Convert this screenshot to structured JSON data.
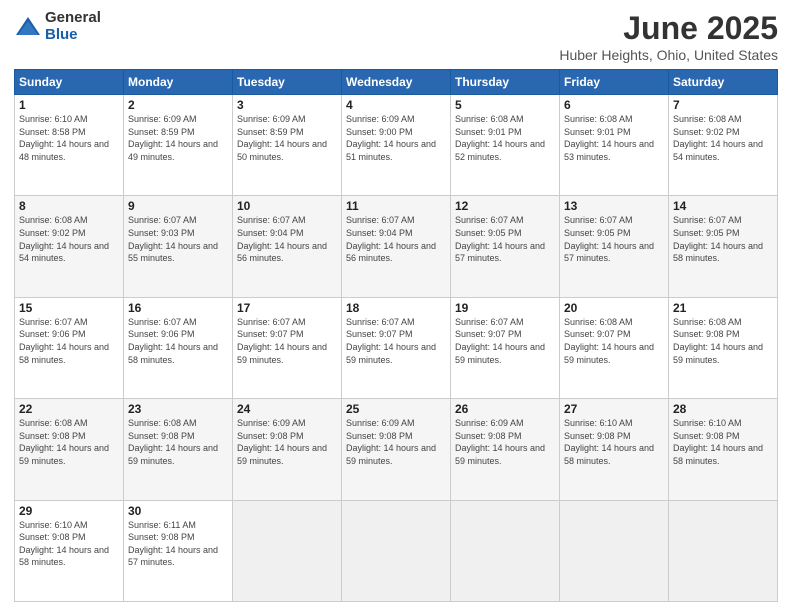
{
  "logo": {
    "general": "General",
    "blue": "Blue"
  },
  "title": "June 2025",
  "subtitle": "Huber Heights, Ohio, United States",
  "header": {
    "days": [
      "Sunday",
      "Monday",
      "Tuesday",
      "Wednesday",
      "Thursday",
      "Friday",
      "Saturday"
    ]
  },
  "weeks": [
    [
      {
        "day": "1",
        "sunrise": "6:10 AM",
        "sunset": "8:58 PM",
        "daylight": "14 hours and 48 minutes."
      },
      {
        "day": "2",
        "sunrise": "6:09 AM",
        "sunset": "8:59 PM",
        "daylight": "14 hours and 49 minutes."
      },
      {
        "day": "3",
        "sunrise": "6:09 AM",
        "sunset": "8:59 PM",
        "daylight": "14 hours and 50 minutes."
      },
      {
        "day": "4",
        "sunrise": "6:09 AM",
        "sunset": "9:00 PM",
        "daylight": "14 hours and 51 minutes."
      },
      {
        "day": "5",
        "sunrise": "6:08 AM",
        "sunset": "9:01 PM",
        "daylight": "14 hours and 52 minutes."
      },
      {
        "day": "6",
        "sunrise": "6:08 AM",
        "sunset": "9:01 PM",
        "daylight": "14 hours and 53 minutes."
      },
      {
        "day": "7",
        "sunrise": "6:08 AM",
        "sunset": "9:02 PM",
        "daylight": "14 hours and 54 minutes."
      }
    ],
    [
      {
        "day": "8",
        "sunrise": "6:08 AM",
        "sunset": "9:02 PM",
        "daylight": "14 hours and 54 minutes."
      },
      {
        "day": "9",
        "sunrise": "6:07 AM",
        "sunset": "9:03 PM",
        "daylight": "14 hours and 55 minutes."
      },
      {
        "day": "10",
        "sunrise": "6:07 AM",
        "sunset": "9:04 PM",
        "daylight": "14 hours and 56 minutes."
      },
      {
        "day": "11",
        "sunrise": "6:07 AM",
        "sunset": "9:04 PM",
        "daylight": "14 hours and 56 minutes."
      },
      {
        "day": "12",
        "sunrise": "6:07 AM",
        "sunset": "9:05 PM",
        "daylight": "14 hours and 57 minutes."
      },
      {
        "day": "13",
        "sunrise": "6:07 AM",
        "sunset": "9:05 PM",
        "daylight": "14 hours and 57 minutes."
      },
      {
        "day": "14",
        "sunrise": "6:07 AM",
        "sunset": "9:05 PM",
        "daylight": "14 hours and 58 minutes."
      }
    ],
    [
      {
        "day": "15",
        "sunrise": "6:07 AM",
        "sunset": "9:06 PM",
        "daylight": "14 hours and 58 minutes."
      },
      {
        "day": "16",
        "sunrise": "6:07 AM",
        "sunset": "9:06 PM",
        "daylight": "14 hours and 58 minutes."
      },
      {
        "day": "17",
        "sunrise": "6:07 AM",
        "sunset": "9:07 PM",
        "daylight": "14 hours and 59 minutes."
      },
      {
        "day": "18",
        "sunrise": "6:07 AM",
        "sunset": "9:07 PM",
        "daylight": "14 hours and 59 minutes."
      },
      {
        "day": "19",
        "sunrise": "6:07 AM",
        "sunset": "9:07 PM",
        "daylight": "14 hours and 59 minutes."
      },
      {
        "day": "20",
        "sunrise": "6:08 AM",
        "sunset": "9:07 PM",
        "daylight": "14 hours and 59 minutes."
      },
      {
        "day": "21",
        "sunrise": "6:08 AM",
        "sunset": "9:08 PM",
        "daylight": "14 hours and 59 minutes."
      }
    ],
    [
      {
        "day": "22",
        "sunrise": "6:08 AM",
        "sunset": "9:08 PM",
        "daylight": "14 hours and 59 minutes."
      },
      {
        "day": "23",
        "sunrise": "6:08 AM",
        "sunset": "9:08 PM",
        "daylight": "14 hours and 59 minutes."
      },
      {
        "day": "24",
        "sunrise": "6:09 AM",
        "sunset": "9:08 PM",
        "daylight": "14 hours and 59 minutes."
      },
      {
        "day": "25",
        "sunrise": "6:09 AM",
        "sunset": "9:08 PM",
        "daylight": "14 hours and 59 minutes."
      },
      {
        "day": "26",
        "sunrise": "6:09 AM",
        "sunset": "9:08 PM",
        "daylight": "14 hours and 59 minutes."
      },
      {
        "day": "27",
        "sunrise": "6:10 AM",
        "sunset": "9:08 PM",
        "daylight": "14 hours and 58 minutes."
      },
      {
        "day": "28",
        "sunrise": "6:10 AM",
        "sunset": "9:08 PM",
        "daylight": "14 hours and 58 minutes."
      }
    ],
    [
      {
        "day": "29",
        "sunrise": "6:10 AM",
        "sunset": "9:08 PM",
        "daylight": "14 hours and 58 minutes."
      },
      {
        "day": "30",
        "sunrise": "6:11 AM",
        "sunset": "9:08 PM",
        "daylight": "14 hours and 57 minutes."
      },
      null,
      null,
      null,
      null,
      null
    ]
  ]
}
